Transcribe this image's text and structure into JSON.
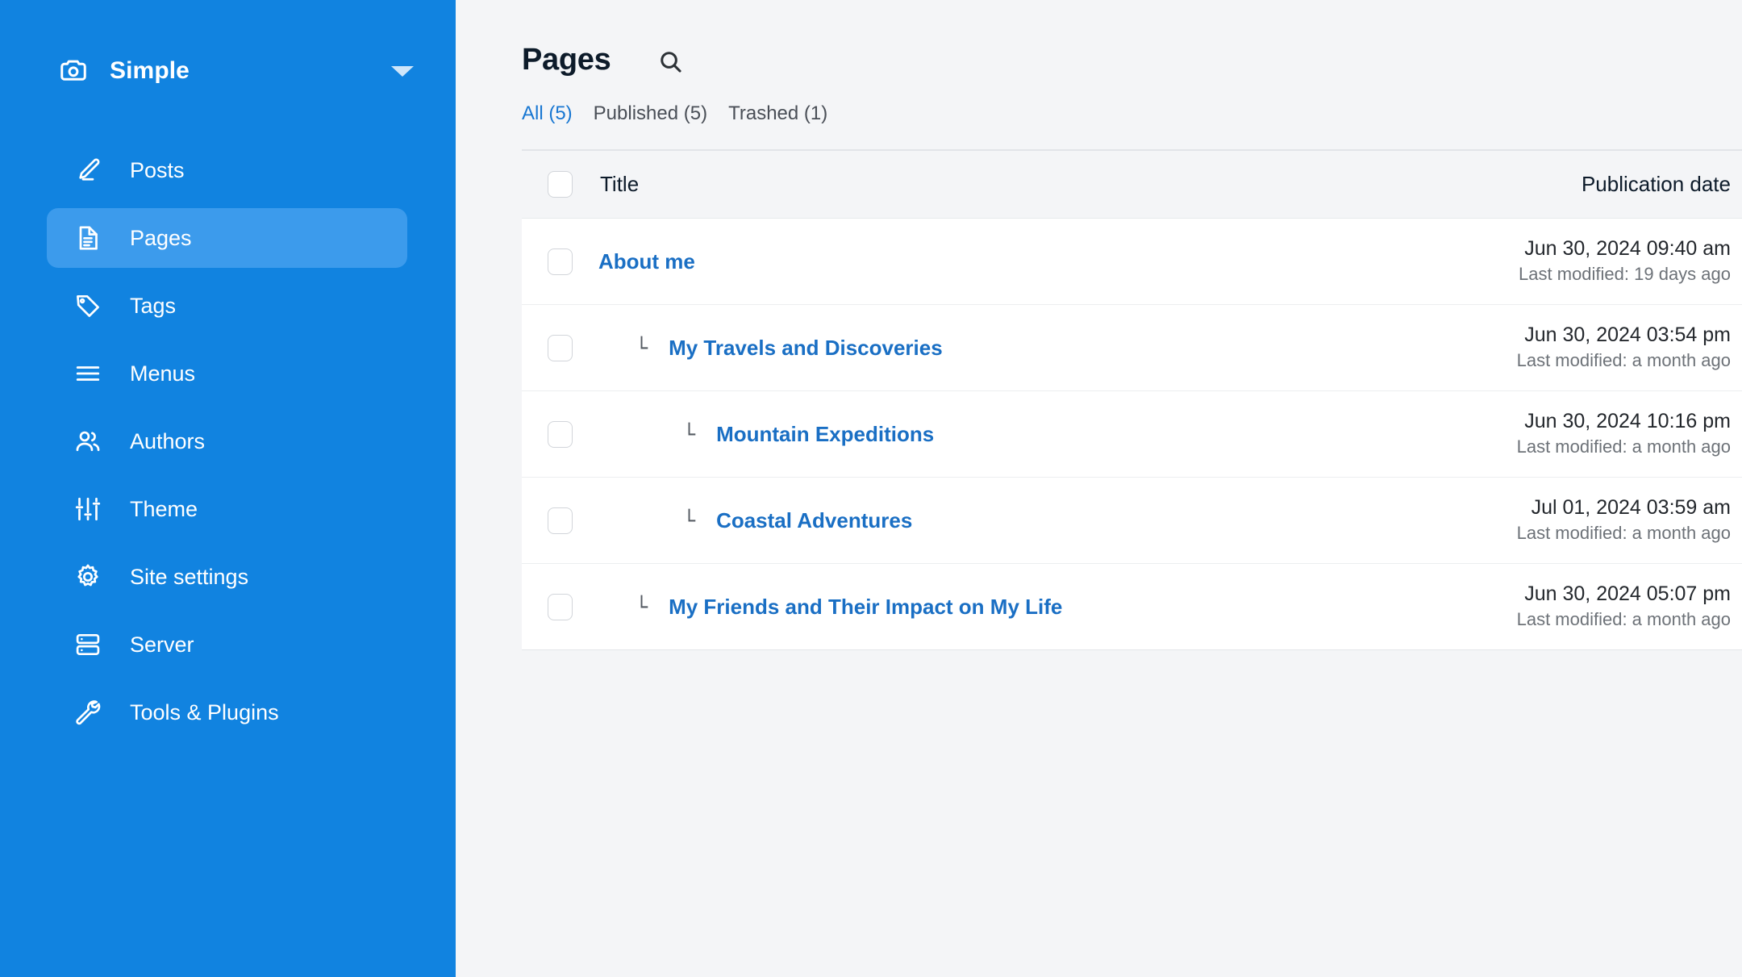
{
  "sidebar": {
    "brand": {
      "name": "Simple",
      "icon": "camera-icon",
      "caret": "chevron-down-icon"
    },
    "items": [
      {
        "label": "Posts",
        "icon": "pencil-icon",
        "active": false
      },
      {
        "label": "Pages",
        "icon": "document-icon",
        "active": true
      },
      {
        "label": "Tags",
        "icon": "tag-icon",
        "active": false
      },
      {
        "label": "Menus",
        "icon": "menu-icon",
        "active": false
      },
      {
        "label": "Authors",
        "icon": "users-icon",
        "active": false
      },
      {
        "label": "Theme",
        "icon": "sliders-icon",
        "active": false
      },
      {
        "label": "Site settings",
        "icon": "gear-icon",
        "active": false
      },
      {
        "label": "Server",
        "icon": "server-icon",
        "active": false
      },
      {
        "label": "Tools & Plugins",
        "icon": "wrench-icon",
        "active": false
      }
    ]
  },
  "header": {
    "title": "Pages",
    "search_icon": "search-icon"
  },
  "tabs": [
    {
      "label": "All (5)",
      "active": true
    },
    {
      "label": "Published (5)",
      "active": false
    },
    {
      "label": "Trashed (1)",
      "active": false
    }
  ],
  "table": {
    "columns": {
      "title": "Title",
      "date": "Publication date"
    },
    "select_all_checkbox": "unchecked",
    "rows": [
      {
        "title": "About me",
        "indent": 0,
        "tree_mark": "",
        "date": "Jun 30, 2024 09:40 am",
        "modified": "Last modified: 19 days ago",
        "checkbox": "unchecked"
      },
      {
        "title": "My Travels and Discoveries",
        "indent": 1,
        "tree_mark": "└",
        "date": "Jun 30, 2024 03:54 pm",
        "modified": "Last modified: a month ago",
        "checkbox": "unchecked"
      },
      {
        "title": "Mountain Expeditions",
        "indent": 2,
        "tree_mark": "└",
        "date": "Jun 30, 2024 10:16 pm",
        "modified": "Last modified: a month ago",
        "checkbox": "unchecked"
      },
      {
        "title": "Coastal Adventures",
        "indent": 2,
        "tree_mark": "└",
        "date": "Jul 01, 2024 03:59 am",
        "modified": "Last modified: a month ago",
        "checkbox": "unchecked"
      },
      {
        "title": "My Friends and Their Impact on My Life",
        "indent": 1,
        "tree_mark": "└",
        "date": "Jun 30, 2024 05:07 pm",
        "modified": "Last modified: a month ago",
        "checkbox": "unchecked"
      }
    ]
  },
  "colors": {
    "sidebar_bg": "#1183e0",
    "sidebar_active": "#3c9bec",
    "page_bg": "#f4f5f7",
    "row_bg": "#ffffff",
    "link": "#1a6fc4",
    "tab_active": "#1877d2",
    "text": "#0d1b2a",
    "muted": "#6d7278"
  }
}
